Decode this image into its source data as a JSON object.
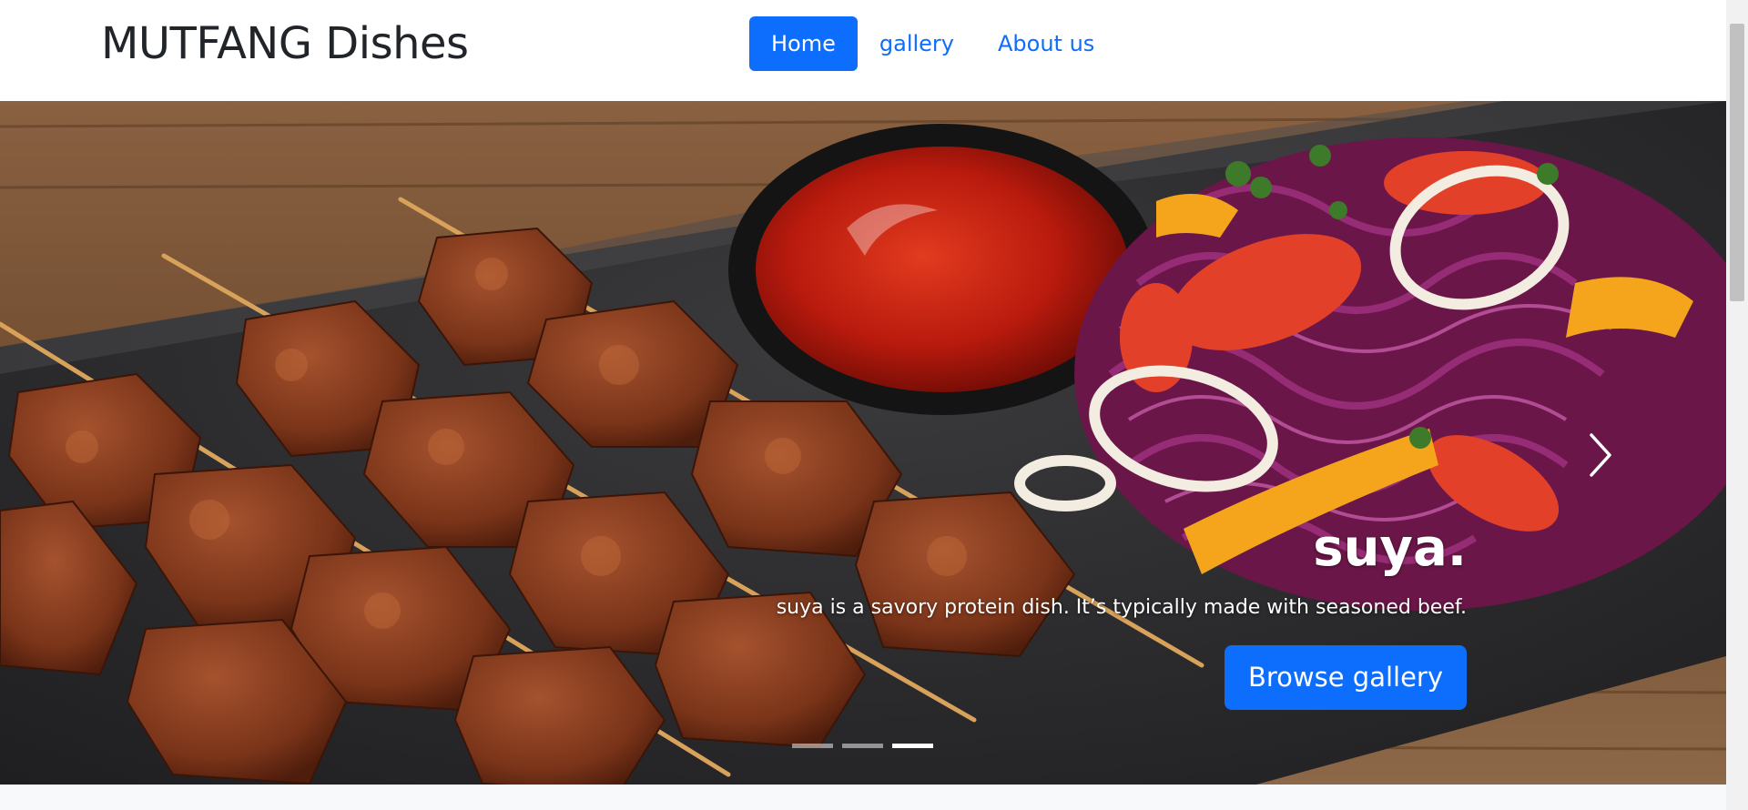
{
  "header": {
    "brand": "MUTFANG Dishes",
    "nav": [
      {
        "label": "Home",
        "active": true
      },
      {
        "label": "gallery",
        "active": false
      },
      {
        "label": "About us",
        "active": false
      }
    ]
  },
  "carousel": {
    "slide": {
      "title": "suya.",
      "description": "suya is a savory protein dish. It’s typically made with seasoned beef.",
      "button_label": "Browse gallery",
      "image": "suya-skewers-with-ketchup-and-salad"
    },
    "slide_count": 3,
    "active_slide": 3,
    "controls": {
      "next_icon": "chevron-right-icon"
    }
  },
  "colors": {
    "primary": "#0d6efd",
    "text": "#212529",
    "page_bg": "#f8f9fa"
  }
}
